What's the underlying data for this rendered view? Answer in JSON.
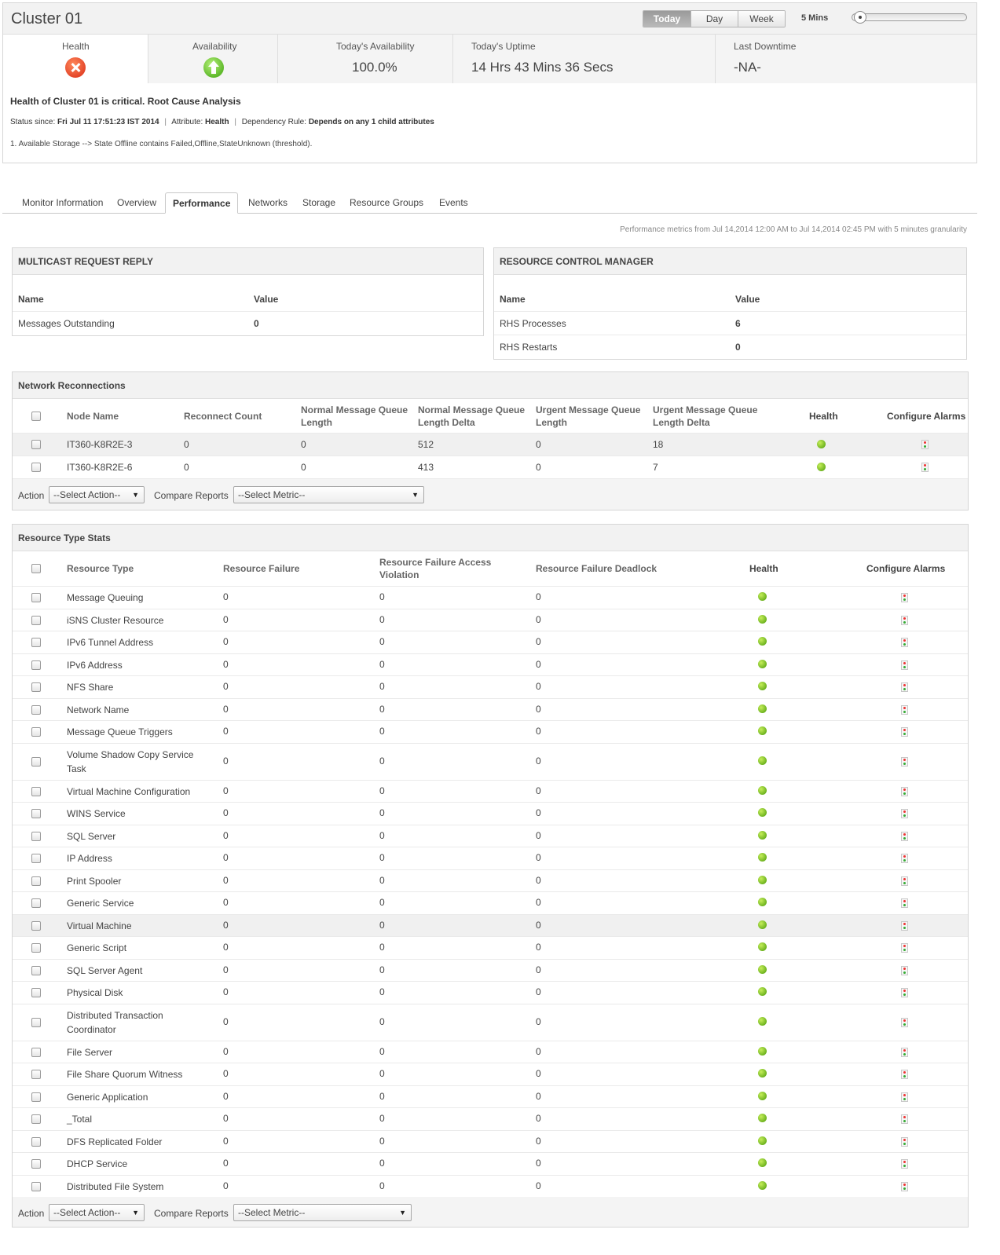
{
  "header": {
    "title": "Cluster 01",
    "periods": [
      "Today",
      "Day",
      "Week"
    ],
    "interval": "5 Mins",
    "stats": {
      "health_label": "Health",
      "availability_label": "Availability",
      "todays_availability_label": "Today's Availability",
      "todays_availability_value": "100.0%",
      "todays_uptime_label": "Today's Uptime",
      "todays_uptime_value": "14 Hrs 43 Mins 36 Secs",
      "last_downtime_label": "Last Downtime",
      "last_downtime_value": "-NA-"
    },
    "rca_title": "Health of Cluster 01 is critical. Root Cause Analysis",
    "status_since_label": "Status since:",
    "status_since_value": "Fri Jul 11 17:51:23 IST 2014",
    "attribute_label": "Attribute:",
    "attribute_value": "Health",
    "dependency_label": "Dependency Rule:",
    "dependency_value": "Depends on any 1 child attributes",
    "cause": "1. Available Storage --> State Offline contains Failed,Offline,StateUnknown (threshold).",
    "colors": {
      "critical": "#e4462a",
      "up": "#5fb92b",
      "healthy": "#69b01c"
    }
  },
  "tabs": [
    "Monitor Information",
    "Overview",
    "Performance",
    "Networks",
    "Storage",
    "Resource Groups",
    "Events"
  ],
  "perf_note": "Performance metrics from Jul 14,2014 12:00 AM to Jul 14,2014 02:45 PM with 5 minutes granularity",
  "multicast": {
    "title": "MULTICAST REQUEST REPLY",
    "col_name": "Name",
    "col_value": "Value",
    "rows": [
      {
        "name": "Messages Outstanding",
        "value": "0"
      }
    ]
  },
  "rcm": {
    "title": "RESOURCE CONTROL MANAGER",
    "col_name": "Name",
    "col_value": "Value",
    "rows": [
      {
        "name": "RHS Processes",
        "value": "6"
      },
      {
        "name": "RHS Restarts",
        "value": "0"
      }
    ]
  },
  "network": {
    "title": "Network Reconnections",
    "headers": {
      "node": "Node Name",
      "reconnect": "Reconnect Count",
      "nmql_1": "Normal Message Queue",
      "nmql_2": "Length",
      "nmqld_1": "Normal Message Queue",
      "nmqld_2": "Length Delta",
      "umql_1": "Urgent Message Queue",
      "umql_2": "Length",
      "umqld_1": "Urgent Message Queue",
      "umqld_2": "Length Delta",
      "health": "Health",
      "alarms": "Configure Alarms"
    },
    "rows": [
      {
        "node": "IT360-K8R2E-3",
        "reconnect": "0",
        "nmql": "0",
        "nmqld": "512",
        "umql": "0",
        "umqld": "18"
      },
      {
        "node": "IT360-K8R2E-6",
        "reconnect": "0",
        "nmql": "0",
        "nmqld": "413",
        "umql": "0",
        "umqld": "7"
      }
    ],
    "action_label": "Action",
    "action_select": "--Select Action--",
    "compare_label": "Compare Reports",
    "metric_select": "--Select Metric--"
  },
  "resource": {
    "title": "Resource Type Stats",
    "headers": {
      "type": "Resource Type",
      "failure": "Resource Failure",
      "access_1": "Resource Failure Access",
      "access_2": "Violation",
      "deadlock": "Resource Failure Deadlock",
      "health": "Health",
      "alarms": "Configure Alarms"
    },
    "rows": [
      {
        "l1": "Message Queuing",
        "l2": "",
        "f": "0",
        "a": "0",
        "d": "0"
      },
      {
        "l1": "iSNS Cluster Resource",
        "l2": "",
        "f": "0",
        "a": "0",
        "d": "0"
      },
      {
        "l1": "IPv6 Tunnel Address",
        "l2": "",
        "f": "0",
        "a": "0",
        "d": "0"
      },
      {
        "l1": "IPv6 Address",
        "l2": "",
        "f": "0",
        "a": "0",
        "d": "0"
      },
      {
        "l1": "NFS Share",
        "l2": "",
        "f": "0",
        "a": "0",
        "d": "0"
      },
      {
        "l1": "Network Name",
        "l2": "",
        "f": "0",
        "a": "0",
        "d": "0"
      },
      {
        "l1": "Message Queue Triggers",
        "l2": "",
        "f": "0",
        "a": "0",
        "d": "0"
      },
      {
        "l1": "Volume Shadow Copy Service",
        "l2": "Task",
        "f": "0",
        "a": "0",
        "d": "0"
      },
      {
        "l1": "Virtual Machine Configuration",
        "l2": "",
        "f": "0",
        "a": "0",
        "d": "0"
      },
      {
        "l1": "WINS Service",
        "l2": "",
        "f": "0",
        "a": "0",
        "d": "0"
      },
      {
        "l1": "SQL Server",
        "l2": "",
        "f": "0",
        "a": "0",
        "d": "0"
      },
      {
        "l1": "IP Address",
        "l2": "",
        "f": "0",
        "a": "0",
        "d": "0"
      },
      {
        "l1": "Print Spooler",
        "l2": "",
        "f": "0",
        "a": "0",
        "d": "0"
      },
      {
        "l1": "Generic Service",
        "l2": "",
        "f": "0",
        "a": "0",
        "d": "0"
      },
      {
        "l1": "Virtual Machine",
        "l2": "",
        "f": "0",
        "a": "0",
        "d": "0"
      },
      {
        "l1": "Generic Script",
        "l2": "",
        "f": "0",
        "a": "0",
        "d": "0"
      },
      {
        "l1": "SQL Server Agent",
        "l2": "",
        "f": "0",
        "a": "0",
        "d": "0"
      },
      {
        "l1": "Physical Disk",
        "l2": "",
        "f": "0",
        "a": "0",
        "d": "0"
      },
      {
        "l1": "Distributed Transaction",
        "l2": "Coordinator",
        "f": "0",
        "a": "0",
        "d": "0"
      },
      {
        "l1": "File Server",
        "l2": "",
        "f": "0",
        "a": "0",
        "d": "0"
      },
      {
        "l1": "File Share Quorum Witness",
        "l2": "",
        "f": "0",
        "a": "0",
        "d": "0"
      },
      {
        "l1": "Generic Application",
        "l2": "",
        "f": "0",
        "a": "0",
        "d": "0"
      },
      {
        "l1": "_Total",
        "l2": "",
        "f": "0",
        "a": "0",
        "d": "0"
      },
      {
        "l1": "DFS Replicated Folder",
        "l2": "",
        "f": "0",
        "a": "0",
        "d": "0"
      },
      {
        "l1": "DHCP Service",
        "l2": "",
        "f": "0",
        "a": "0",
        "d": "0"
      },
      {
        "l1": "Distributed File System",
        "l2": "",
        "f": "0",
        "a": "0",
        "d": "0"
      }
    ],
    "action_label": "Action",
    "action_select": "--Select Action--",
    "compare_label": "Compare Reports",
    "metric_select": "--Select Metric--"
  }
}
